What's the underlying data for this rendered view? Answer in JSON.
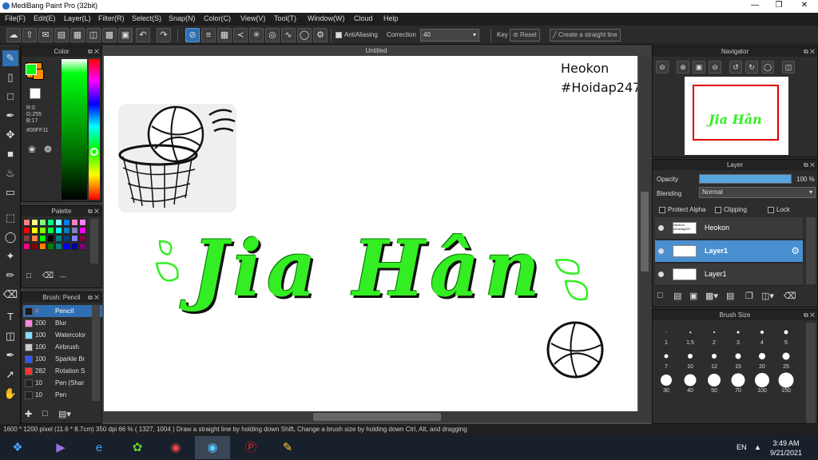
{
  "window": {
    "title": "MediBang Paint Pro (32bit)"
  },
  "menu": [
    "File(F)",
    "Edit(E)",
    "Layer(L)",
    "Filter(R)",
    "Select(S)",
    "Snap(N)",
    "Color(C)",
    "View(V)",
    "Tool(T)",
    "Window(W)",
    "Cloud",
    "Help"
  ],
  "toolbar": {
    "antialiasing_label": "AntiAliasing",
    "correction_label": "Correction",
    "correction_value": "40",
    "key_label": "Key",
    "reset_label": "Reset",
    "straight_line_label": "Create a straight line"
  },
  "color_panel": {
    "title": "Color",
    "r": "R:0",
    "g": "G:255",
    "b": "B:17",
    "hex": "#00FF11",
    "fg": "#00ff11",
    "bg": "#ff8c00"
  },
  "palette_panel": {
    "title": "Palette",
    "colors": [
      "#ff8080",
      "#ffff80",
      "#80ff80",
      "#00ff80",
      "#80ffff",
      "#0080ff",
      "#ff80c0",
      "#ff80ff",
      "#ff0000",
      "#ffff00",
      "#80ff00",
      "#00ff40",
      "#00ffff",
      "#0080c0",
      "#8080c0",
      "#ff00ff",
      "#804040",
      "#ff8040",
      "#00ff00",
      "#000000",
      "#008080",
      "#004080",
      "#8080ff",
      "#800040",
      "#ff0080",
      "#800000",
      "#ff8000",
      "#008000",
      "#008080",
      "#0000ff",
      "#0000a0",
      "#800080"
    ],
    "footer": "---"
  },
  "brush_panel": {
    "title": "Brush: Pencil",
    "items": [
      {
        "size": "4",
        "name": "Pencil",
        "color": "#1a1a1a"
      },
      {
        "size": "200",
        "name": "Blur",
        "color": "#ff88dd"
      },
      {
        "size": "100",
        "name": "Watercolor",
        "color": "#88ddff"
      },
      {
        "size": "100",
        "name": "Airbrush",
        "color": "#cccccc"
      },
      {
        "size": "100",
        "name": "Sparkle Br",
        "color": "#3355ff"
      },
      {
        "size": "282",
        "name": "Rotation S",
        "color": "#ff3333"
      },
      {
        "size": "10",
        "name": "Pen (Shar",
        "color": "#222222"
      },
      {
        "size": "10",
        "name": "Pen",
        "color": "#222222"
      }
    ]
  },
  "canvas": {
    "tab_title": "Untitled",
    "watermark_line1": "Heokon",
    "watermark_line2": "#Hoidap247",
    "artwork_text": "Jia Hân",
    "artwork_color": "#33ee22"
  },
  "navigator": {
    "title": "Navigator",
    "preview_text": "Jia Hân"
  },
  "layer_panel": {
    "title": "Layer",
    "opacity_label": "Opacity",
    "opacity_value": "100 %",
    "opacity_fraction": 1.0,
    "blending_label": "Blending",
    "blending_value": "Normal",
    "protect_alpha": "Protect Alpha",
    "clipping": "Clipping",
    "lock": "Lock",
    "layers": [
      {
        "name": "Heokon",
        "thumb": "Heokon #Hoidap247",
        "selected": false
      },
      {
        "name": "Layer1",
        "selected": true
      },
      {
        "name": "Layer1",
        "selected": false
      }
    ]
  },
  "brush_size_panel": {
    "title": "Brush Size",
    "sizes": [
      "1",
      "1.5",
      "2",
      "3",
      "4",
      "5",
      "7",
      "10",
      "12",
      "15",
      "20",
      "25",
      "30",
      "40",
      "50",
      "70",
      "100",
      "150"
    ]
  },
  "statusbar": {
    "text": "1600 * 1200 pixel  (11.6 * 8.7cm)  350 dpi  66 %  ( 1327, 1004 )  Draw a straight line by holding down Shift, Change a brush size by holding down Ctrl, Alt, and dragging"
  },
  "taskbar": {
    "lang": "EN",
    "time": "3:49 AM",
    "date": "9/21/2021"
  }
}
